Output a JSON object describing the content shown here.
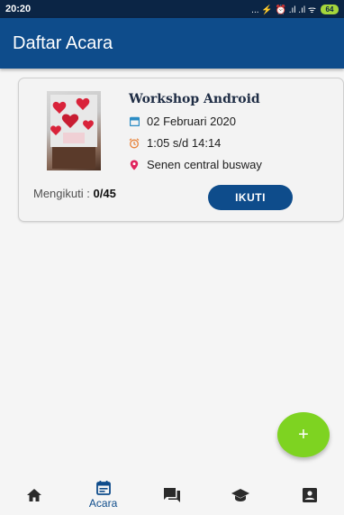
{
  "status_bar": {
    "time": "20:20",
    "icons_text": "... ⚡ ⏰ .ıl .ıl ᯤ",
    "battery": "64"
  },
  "appbar": {
    "title": "Daftar Acara"
  },
  "event": {
    "title": "Workshop Android",
    "date": "02 Februari 2020",
    "time": "1:05 s/d 14:14",
    "location": "Senen central busway",
    "followers_label": "Mengikuti :",
    "followers_count": "0/45",
    "button_label": "IKUTI"
  },
  "fab": {
    "label": "+"
  },
  "bottom_nav": {
    "active_label": "Acara",
    "items": [
      "home-icon",
      "calendar-icon",
      "chat-icon",
      "school-icon",
      "profile-icon"
    ]
  },
  "colors": {
    "primary": "#0e4c8b",
    "status_bar": "#0b2545",
    "fab": "#7ed321",
    "date_icon": "#2b8cc4",
    "time_icon": "#e8833a",
    "location_icon": "#e0245e"
  }
}
